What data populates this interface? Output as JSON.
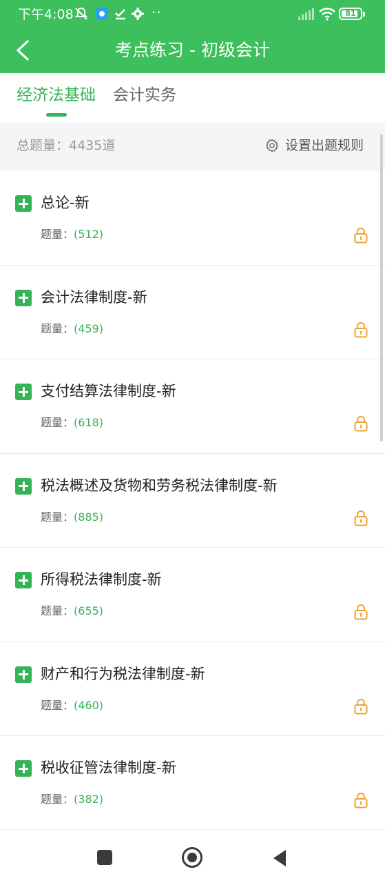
{
  "status_bar": {
    "time": "下午4:08",
    "dots": "··",
    "battery_level": "81"
  },
  "app_bar": {
    "title": "考点练习 - 初级会计",
    "back_icon": "chevron-left-icon"
  },
  "tabs": [
    {
      "label": "经济法基础",
      "active": true
    },
    {
      "label": "会计实务",
      "active": false
    }
  ],
  "summary": {
    "total_label": "总题量：4435道",
    "rules_label": "设置出题规则",
    "rules_icon": "gear-icon"
  },
  "list": {
    "count_prefix": "题量：",
    "items": [
      {
        "title": "总论-新",
        "count": "(512)"
      },
      {
        "title": "会计法律制度-新",
        "count": "(459)"
      },
      {
        "title": "支付结算法律制度-新",
        "count": "(618)"
      },
      {
        "title": "税法概述及货物和劳务税法律制度-新",
        "count": "(885)"
      },
      {
        "title": "所得税法律制度-新",
        "count": "(655)"
      },
      {
        "title": "财产和行为税法律制度-新",
        "count": "(460)"
      },
      {
        "title": "税收征管法律制度-新",
        "count": "(382)"
      }
    ]
  },
  "colors": {
    "brand_green": "#3cbf5c",
    "accent_green": "#34b457",
    "lock_orange": "#f0a030"
  },
  "nav_bar": {
    "icons": [
      "recent-apps-icon",
      "home-icon",
      "back-icon"
    ]
  }
}
